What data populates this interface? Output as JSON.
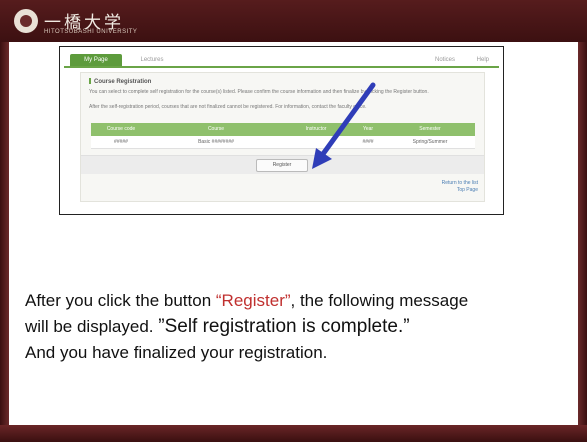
{
  "header": {
    "logo_text": "一橋大学",
    "logo_sub": "HITOTSUBASHI UNIVERSITY"
  },
  "screenshot": {
    "tabs": {
      "active": "My Page",
      "inactive": "Lectures",
      "right1": "Notices",
      "right2": "Help"
    },
    "section_title": "Course Registration",
    "paragraph1": "You can select to complete self registration for the course(s) listed. Please confirm the course information and then finalize by clicking the Register button.",
    "paragraph2": "After the self-registration period, courses that are not finalized cannot be registered. For information, contact the faculty office.",
    "table": {
      "headers": [
        "Course code",
        "Course",
        "Instructor",
        "Year",
        "Semester"
      ],
      "rows": [
        [
          "#####",
          "Basic ########",
          "",
          "####",
          "Spring/Summer"
        ]
      ]
    },
    "register_button": "Register",
    "links": [
      "Return to the list",
      "Top Page"
    ]
  },
  "message": {
    "line1_prefix": "After you click the button ",
    "line1_highlight": "“Register”",
    "line1_suffix": ", the following message",
    "line2_prefix": "will be displayed. ",
    "line2_quote": "”Self registration is complete.”",
    "line3": "And you have finalized your registration."
  },
  "colors": {
    "frame": "#4a1415",
    "accent_green": "#6aa447",
    "arrow": "#2f3db8",
    "highlight_red": "#c0302f"
  }
}
